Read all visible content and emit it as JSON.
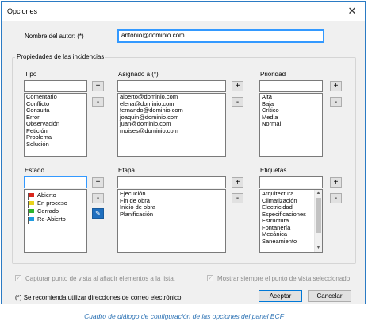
{
  "dialog": {
    "title": "Opciones",
    "close_glyph": "✕",
    "author_label": "Nombre del autor: (*)",
    "author_value": "antonio@dominio.com",
    "group_label": "Propiedades de las incidencias",
    "tipo": {
      "label": "Tipo",
      "items": [
        "Comentario",
        "Conflicto",
        "Consulta",
        "Error",
        "Observación",
        "Petición",
        "Problema",
        "Solución"
      ]
    },
    "asignado": {
      "label": "Asignado a (*)",
      "items": [
        "alberto@dominio.com",
        "elena@dominio.com",
        "fernando@dominio.com",
        "joaquin@dominio.com",
        "juan@dominio.com",
        "moises@dominio.com"
      ]
    },
    "prioridad": {
      "label": "Prioridad",
      "items": [
        "Alta",
        "Baja",
        "Crítico",
        "Media",
        "Normal"
      ]
    },
    "estado": {
      "label": "Estado",
      "items": [
        {
          "label": "Abierto",
          "color": "#d9261c"
        },
        {
          "label": "En proceso",
          "color": "#e8d21d"
        },
        {
          "label": "Cerrado",
          "color": "#2db52d"
        },
        {
          "label": "Re-Abierto",
          "color": "#1e9be0"
        }
      ]
    },
    "etapa": {
      "label": "Etapa",
      "items": [
        "Ejecución",
        "Fin de obra",
        "Inicio de obra",
        "Planificación"
      ]
    },
    "etiquetas": {
      "label": "Etiquetas",
      "items": [
        "Arquitectura",
        "Climatización",
        "Electricidad",
        "Especificaciones",
        "Estructura",
        "Fontanería",
        "Mecánica",
        "Saneamiento"
      ]
    },
    "plus_glyph": "+",
    "minus_glyph": "-",
    "check_glyph": "✓",
    "capture_label": "Capturar punto de vista al añadir elementos a la lista.",
    "show_label": "Mostrar siempre el punto de vista seleccionado.",
    "note": "(*) Se recomienda utilizar direcciones de correo electrónico.",
    "accept_label": "Aceptar",
    "cancel_label": "Cancelar"
  },
  "caption": "Cuadro de diálogo de configuración de las opciones del panel BCF",
  "colors": {
    "accent": "#3399ff",
    "caption": "#2f74b5",
    "border": "#2b7bc4"
  }
}
